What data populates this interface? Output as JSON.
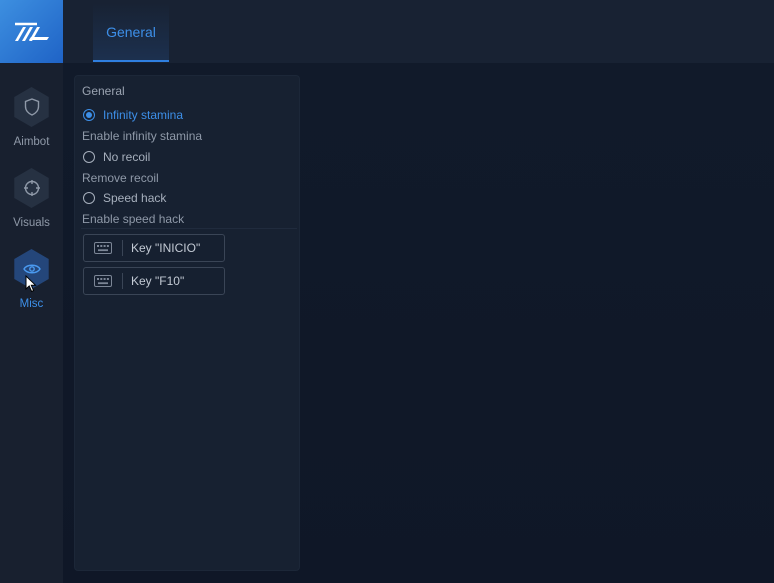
{
  "tabs": [
    {
      "label": "General",
      "active": true
    }
  ],
  "sidebar": {
    "items": [
      {
        "label": "Aimbot",
        "icon": "shield-icon",
        "active": false
      },
      {
        "label": "Visuals",
        "icon": "crosshair-icon",
        "active": false
      },
      {
        "label": "Misc",
        "icon": "eye-icon",
        "active": true
      }
    ]
  },
  "panel": {
    "title": "General",
    "options": [
      {
        "label": "Infinity stamina",
        "description": "Enable infinity stamina",
        "selected": true
      },
      {
        "label": "No recoil",
        "description": "Remove recoil",
        "selected": false
      },
      {
        "label": "Speed hack",
        "description": "Enable speed hack",
        "selected": false
      }
    ],
    "keybinds": [
      {
        "label": "Key \"INICIO\"",
        "icon": "keyboard-icon"
      },
      {
        "label": "Key \"F10\"",
        "icon": "keyboard-icon"
      }
    ]
  },
  "colors": {
    "accent": "#3d8fe8",
    "background": "#111a2a",
    "sidebar": "#18202f",
    "panel": "#172131"
  }
}
